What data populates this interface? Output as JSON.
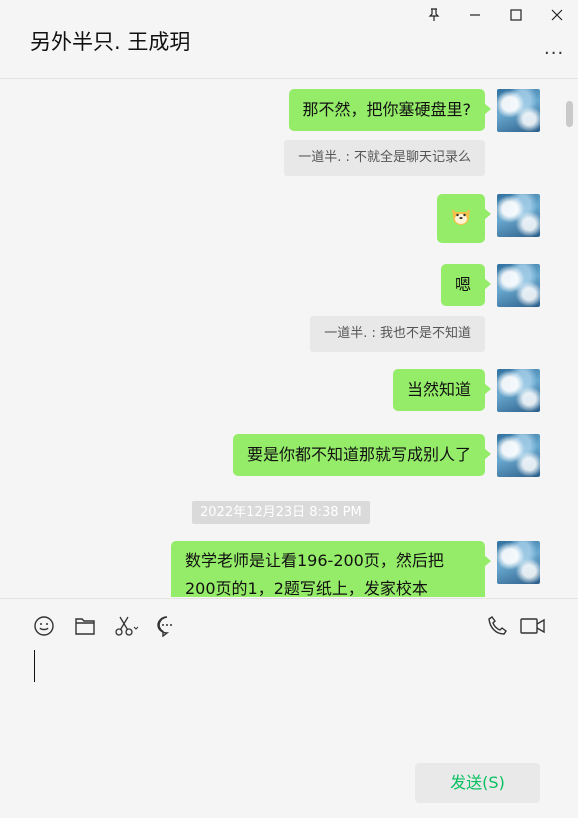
{
  "header": {
    "title": "另外半只. 王成玥",
    "more_label": "..."
  },
  "messages": [
    {
      "type": "text",
      "text": "那不然，把你塞硬盘里?"
    },
    {
      "type": "quote",
      "text": "一道半. : 不就全是聊天记录么"
    },
    {
      "type": "sticker",
      "icon": "doge-emoji-icon"
    },
    {
      "type": "text",
      "text": "嗯"
    },
    {
      "type": "quote",
      "text": "一道半. : 我也不是不知道"
    },
    {
      "type": "text",
      "text": "当然知道"
    },
    {
      "type": "text",
      "text": "要是你都不知道那就写成别人了"
    },
    {
      "type": "timestamp",
      "text": "2022年12月23日 8:38 PM"
    },
    {
      "type": "text",
      "text": "数学老师是让看196-200页，然后把200页的1，2题写纸上，发家校本"
    }
  ],
  "toolbar": {
    "icons": [
      "emoji-icon",
      "folder-icon",
      "scissors-icon",
      "chat-history-icon",
      "phone-icon",
      "video-icon"
    ],
    "send_label": "发送(S)"
  },
  "colors": {
    "bubble_green": "#95ec69",
    "send_text": "#07c160",
    "background": "#f5f5f5"
  }
}
